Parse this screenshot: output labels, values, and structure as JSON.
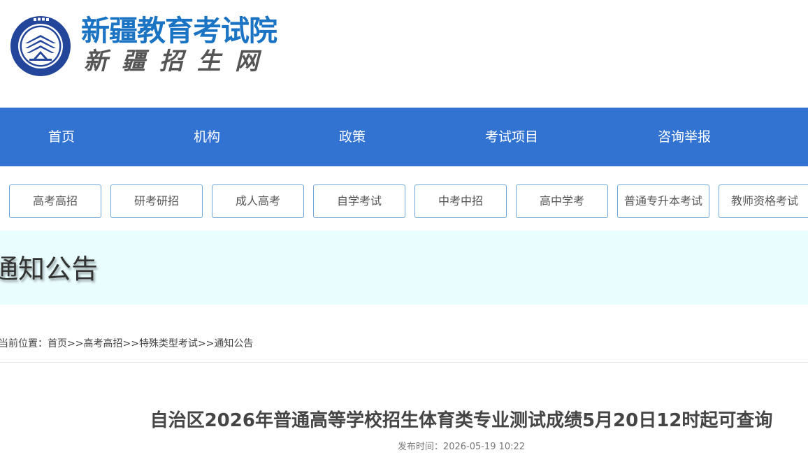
{
  "colors": {
    "brand_blue": "#1b73c4",
    "nav_blue": "#3273d2",
    "emblem_blue": "#23459a",
    "banner_bg": "#e9fcfe",
    "sub_btn_border": "#6fa6d9"
  },
  "header": {
    "title": "新疆教育考试院",
    "subtitle": "新疆招生网",
    "emblem_icon": "exam-institute-emblem-icon"
  },
  "main_nav": {
    "items": [
      {
        "label": "首页"
      },
      {
        "label": "机构"
      },
      {
        "label": "政策"
      },
      {
        "label": "考试项目"
      },
      {
        "label": "咨询举报"
      }
    ]
  },
  "sub_nav": {
    "items": [
      {
        "label": "高考高招"
      },
      {
        "label": "研考研招"
      },
      {
        "label": "成人高考"
      },
      {
        "label": "自学考试"
      },
      {
        "label": "中考中招"
      },
      {
        "label": "高中学考"
      },
      {
        "label": "普通专升本考试"
      },
      {
        "label": "教师资格考试"
      }
    ]
  },
  "banner": {
    "title": "通知公告"
  },
  "breadcrumb": {
    "prefix": "当前位置：",
    "items": [
      "首页",
      "高考高招",
      "特殊类型考试",
      "通知公告"
    ],
    "separator": ">>"
  },
  "article": {
    "title": "自治区2026年普通高等学校招生体育类专业测试成绩5月20日12时起可查询",
    "publish_label": "发布时间：",
    "publish_time": "2026-05-19 10:22"
  }
}
